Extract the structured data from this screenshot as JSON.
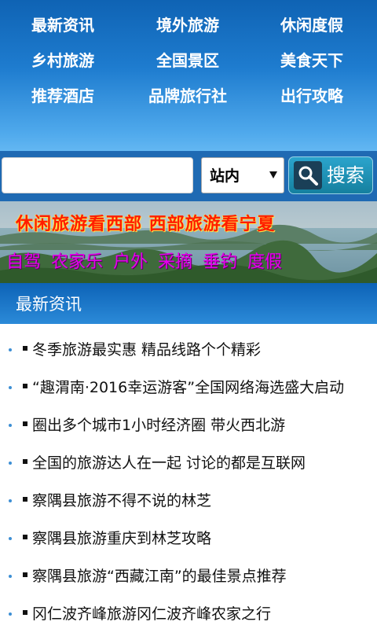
{
  "nav": {
    "items": [
      {
        "label": "最新资讯"
      },
      {
        "label": "境外旅游"
      },
      {
        "label": "休闲度假"
      },
      {
        "label": "乡村旅游"
      },
      {
        "label": "全国景区"
      },
      {
        "label": "美食天下"
      },
      {
        "label": "推荐酒店"
      },
      {
        "label": "品牌旅行社"
      },
      {
        "label": "出行攻略"
      }
    ]
  },
  "search": {
    "input_value": "",
    "scope_selected": "站内",
    "button_label": "搜索"
  },
  "banner": {
    "line1": "休闲旅游看西部   西部旅游看宁夏",
    "line2": "自驾 农家乐 户外 采摘 垂钓 度假"
  },
  "news": {
    "title": "最新资讯",
    "items": [
      {
        "text": "冬季旅游最实惠 精品线路个个精彩"
      },
      {
        "text": "“趣渭南·2016幸运游客”全国网络海选盛大启动"
      },
      {
        "text": "圈出多个城市1小时经济圈 带火西北游"
      },
      {
        "text": "全国的旅游达人在一起 讨论的都是互联网"
      },
      {
        "text": "察隅县旅游不得不说的林芝"
      },
      {
        "text": "察隅县旅游重庆到林芝攻略"
      },
      {
        "text": "察隅县旅游“西藏江南”的最佳景点推荐"
      },
      {
        "text": "冈仁波齐峰旅游冈仁波齐峰农家之行"
      }
    ]
  },
  "colors": {
    "nav_gradient_top": "#0f63b4",
    "nav_gradient_bottom": "#63b7f2",
    "search_row_bg": "#1f6ab3",
    "search_button": "#1f93bb",
    "banner_line1": "#ff1d00",
    "banner_line2": "#e400ee",
    "section_header": "#1574c8",
    "bullet_dot": "#3d8fd4"
  },
  "icons": {
    "search_button_icon": "magnifier-icon"
  }
}
